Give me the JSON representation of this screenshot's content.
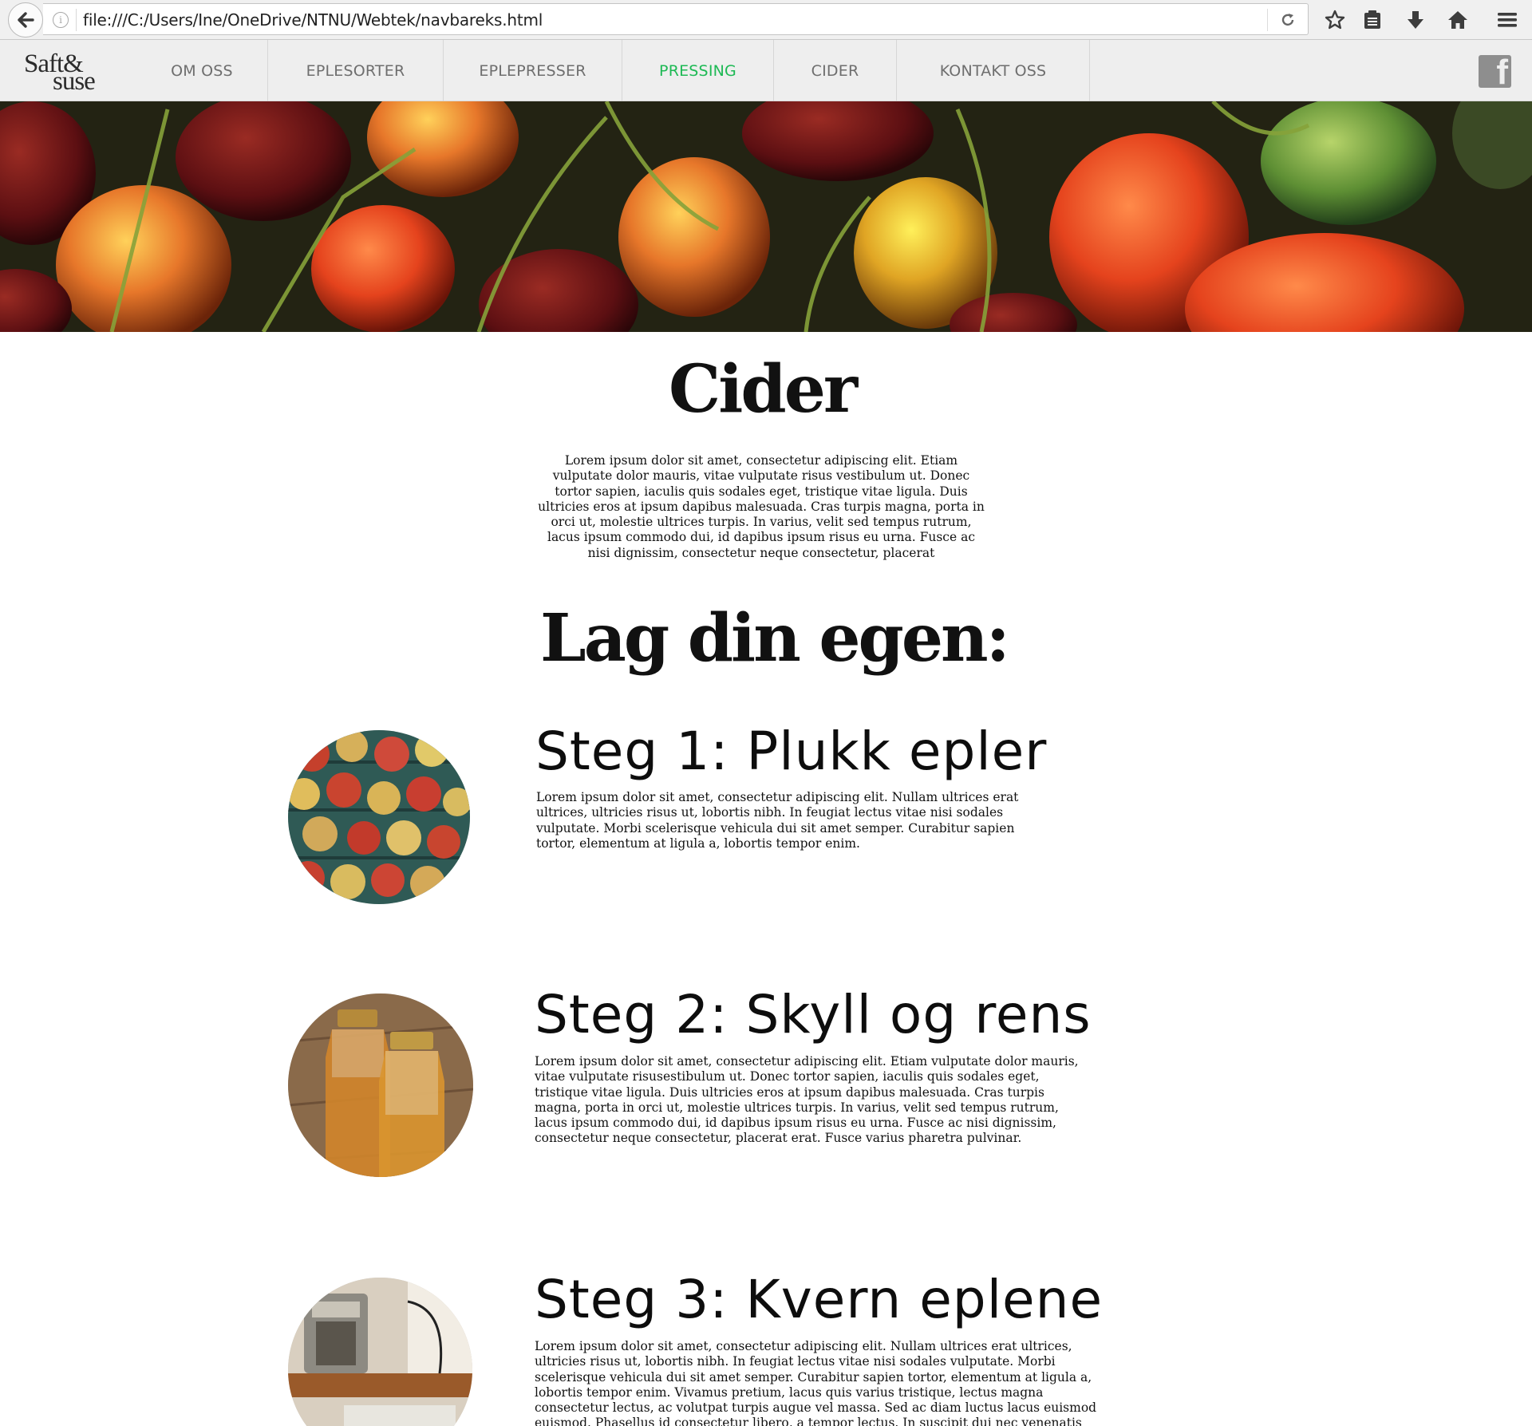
{
  "browser": {
    "url": "file:///C:/Users/Ine/OneDrive/NTNU/Webtek/navbareks.html"
  },
  "site": {
    "logo_line1": "Saft&",
    "logo_line2": "suse",
    "nav": [
      {
        "label": "OM OSS",
        "active": false
      },
      {
        "label": "EPLESORTER",
        "active": false
      },
      {
        "label": "EPLEPRESSER",
        "active": false
      },
      {
        "label": "PRESSING",
        "active": true
      },
      {
        "label": "CIDER",
        "active": false
      },
      {
        "label": "KONTAKT OSS",
        "active": false
      }
    ],
    "active_color": "#1db954",
    "facebook_glyph": "f"
  },
  "main": {
    "title": "Cider",
    "intro": "Lorem ipsum dolor sit amet, consectetur adipiscing elit. Etiam vulputate dolor mauris, vitae vulputate risus vestibulum ut. Donec tortor sapien, iaculis quis sodales eget, tristique vitae ligula. Duis ultricies eros at ipsum dapibus malesuada. Cras turpis magna, porta in orci ut, molestie ultrices turpis. In varius, velit sed tempus rutrum, lacus ipsum commodo dui, id dapibus ipsum risus eu urna. Fusce ac nisi dignissim, consectetur neque consectetur, placerat",
    "subtitle": "Lag din egen:",
    "steps": [
      {
        "title": "Steg 1: Plukk epler",
        "text": "Lorem ipsum dolor sit amet, consectetur adipiscing elit. Nullam ultrices erat ultrices, ultricies risus ut, lobortis nibh. In feugiat lectus vitae nisi sodales vulputate. Morbi scelerisque vehicula dui sit amet semper. Curabitur sapien tortor, elementum at ligula a, lobortis tempor enim."
      },
      {
        "title": "Steg 2: Skyll og rens",
        "text": "Lorem ipsum dolor sit amet, consectetur adipiscing elit. Etiam vulputate dolor mauris, vitae vulputate risusestibulum ut. Donec tortor sapien, iaculis quis sodales eget, tristique vitae ligula. Duis ultricies eros at ipsum dapibus malesuada. Cras turpis magna, porta in orci ut, molestie ultrices turpis. In varius, velit sed tempus rutrum, lacus ipsum commodo dui, id dapibus ipsum risus eu urna. Fusce ac nisi dignissim, consectetur neque consectetur, placerat erat. Fusce varius pharetra pulvinar."
      },
      {
        "title": "Steg 3: Kvern eplene",
        "text": " Lorem ipsum dolor sit amet, consectetur adipiscing elit. Nullam ultrices erat ultrices, ultricies risus ut, lobortis nibh. In feugiat lectus vitae nisi sodales vulputate. Morbi scelerisque vehicula dui sit amet semper. Curabitur sapien tortor, elementum at ligula a, lobortis tempor enim. Vivamus pretium, lacus quis varius tristique, lectus magna consectetur lectus, ac volutpat turpis augue vel massa. Sed ac diam luctus lacus euismod euismod. Phasellus id consectetur libero, a tempor lectus. In suscipit dui nec venenatis lobortis. Maecenas semper, tellus eget eleifend ullamcorper, nulla ante"
      }
    ]
  }
}
